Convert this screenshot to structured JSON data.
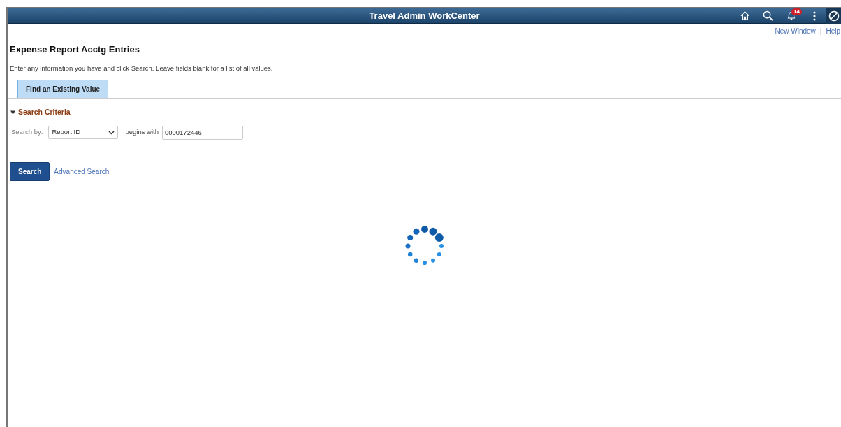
{
  "header": {
    "title": "Travel Admin WorkCenter",
    "notification_count": "14"
  },
  "links": [
    {
      "label": "New Window"
    },
    {
      "label": "Help"
    }
  ],
  "link_separator": "|",
  "page": {
    "title": "Expense Report Acctg Entries",
    "instructions": "Enter any information you have and click Search. Leave fields blank for a list of all values."
  },
  "tabs": [
    {
      "label": "Find an Existing Value",
      "selected": true
    }
  ],
  "search_criteria": {
    "title": "Search Criteria",
    "expanded": true,
    "search_by_label": "Search by:",
    "search_by_value": "Report ID",
    "operator": "begins with",
    "value": "0000172446"
  },
  "buttons": {
    "search": "Search",
    "advanced": "Advanced Search"
  },
  "loading": true
}
